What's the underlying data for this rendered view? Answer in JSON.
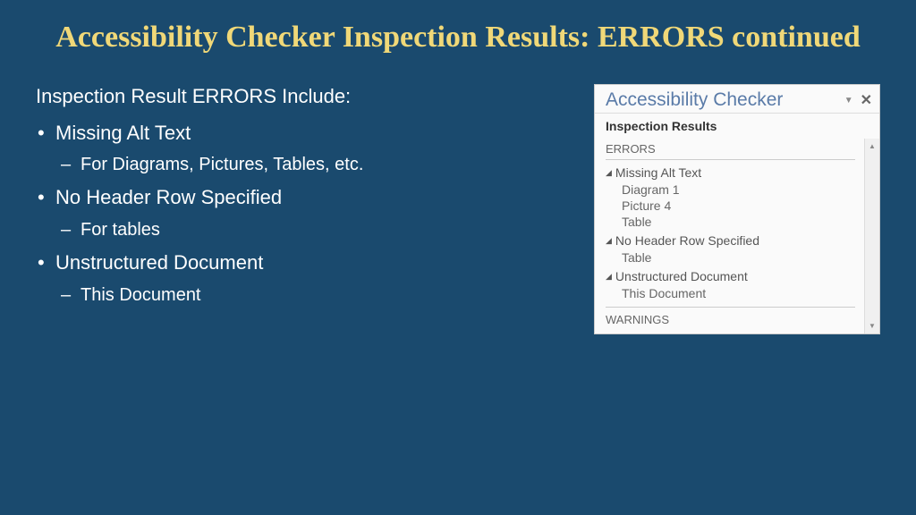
{
  "title": "Accessibility Checker Inspection Results: ERRORS continued",
  "intro": "Inspection Result ERRORS Include:",
  "bullets": [
    {
      "main": "Missing Alt Text",
      "sub": "For Diagrams, Pictures, Tables, etc."
    },
    {
      "main": "No Header Row Specified",
      "sub": "For tables"
    },
    {
      "main": "Unstructured Document",
      "sub": "This Document"
    }
  ],
  "panel": {
    "title": "Accessibility Checker",
    "subtitle": "Inspection Results",
    "errorsLabel": "ERRORS",
    "warningsLabel": "WARNINGS",
    "groups": [
      {
        "name": "Missing Alt Text",
        "items": [
          "Diagram 1",
          "Picture 4",
          "Table"
        ]
      },
      {
        "name": "No Header Row Specified",
        "items": [
          "Table"
        ]
      },
      {
        "name": "Unstructured Document",
        "items": [
          "This Document"
        ]
      }
    ]
  }
}
